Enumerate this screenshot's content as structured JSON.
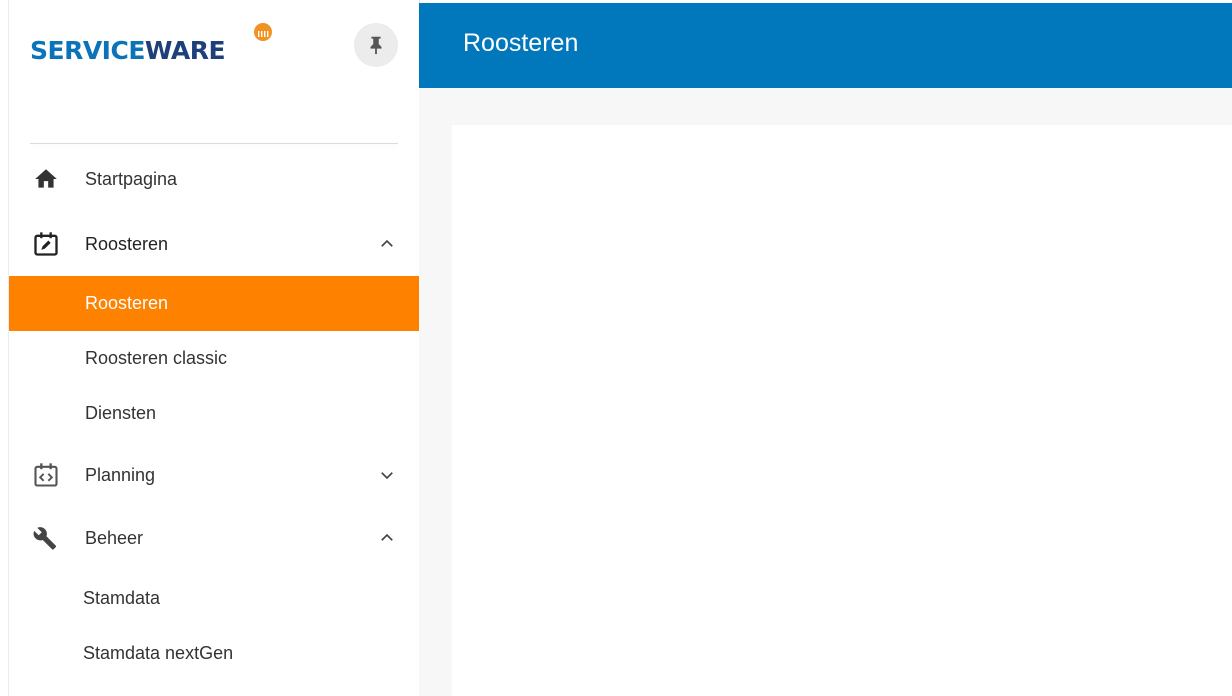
{
  "sidebar": {
    "logo": {
      "part1": "SERVICE",
      "part2": "WARE",
      "accent_color": "#ff8100"
    },
    "pin_icon": "pin-icon",
    "nav": [
      {
        "label": "Startpagina",
        "icon": "home-icon"
      },
      {
        "label": "Roosteren",
        "icon": "calendar-edit-icon",
        "expanded": true,
        "children": [
          "Roosteren",
          "Roosteren classic",
          "Diensten"
        ],
        "active_child": "Roosteren"
      },
      {
        "label": "Planning",
        "icon": "calendar-code-icon",
        "expanded": false
      },
      {
        "label": "Beheer",
        "icon": "wrench-icon",
        "expanded": true,
        "children": [
          "Stamdata",
          "Stamdata nextGen"
        ]
      }
    ]
  },
  "header": {
    "title": "Roosteren",
    "color": "#0078bb"
  },
  "colors": {
    "active_item": "#ff8100",
    "header": "#0078bb"
  }
}
